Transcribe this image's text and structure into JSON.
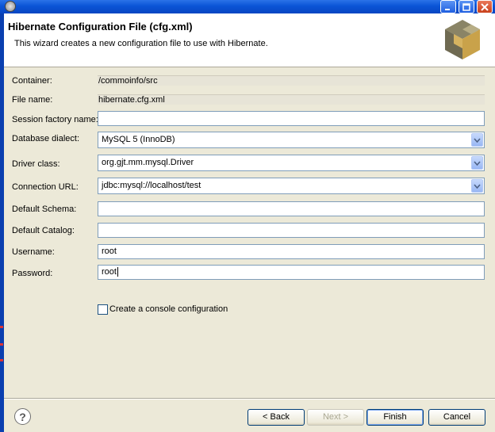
{
  "window": {
    "title": ""
  },
  "header": {
    "title": "Hibernate Configuration File (cfg.xml)",
    "description": "This wizard creates a new configuration file to use with Hibernate.",
    "logo_icon": "hibernate-logo-icon"
  },
  "form": {
    "container": {
      "label": "Container:",
      "value": "/commoinfo/src"
    },
    "file_name": {
      "label": "File name:",
      "value": "hibernate.cfg.xml"
    },
    "session_factory_name": {
      "label": "Session factory name:",
      "value": ""
    },
    "database_dialect": {
      "label": "Database dialect:",
      "value": "MySQL 5 (InnoDB)"
    },
    "driver_class": {
      "label": "Driver class:",
      "value": "org.gjt.mm.mysql.Driver"
    },
    "connection_url": {
      "label": "Connection URL:",
      "value": "jdbc:mysql://localhost/test"
    },
    "default_schema": {
      "label": "Default Schema:",
      "value": ""
    },
    "default_catalog": {
      "label": "Default Catalog:",
      "value": ""
    },
    "username": {
      "label": "Username:",
      "value": "root"
    },
    "password": {
      "label": "Password:",
      "value": "root"
    },
    "console_config": {
      "label": "Create a console configuration",
      "checked": false
    }
  },
  "buttons": {
    "help": "?",
    "back": "< Back",
    "next": "Next >",
    "finish": "Finish",
    "cancel": "Cancel"
  },
  "colors": {
    "titlebar": "#0a54d6",
    "header_bg": "#ffffff",
    "dialog_bg": "#ece9d8",
    "field_border": "#7f9db9"
  }
}
